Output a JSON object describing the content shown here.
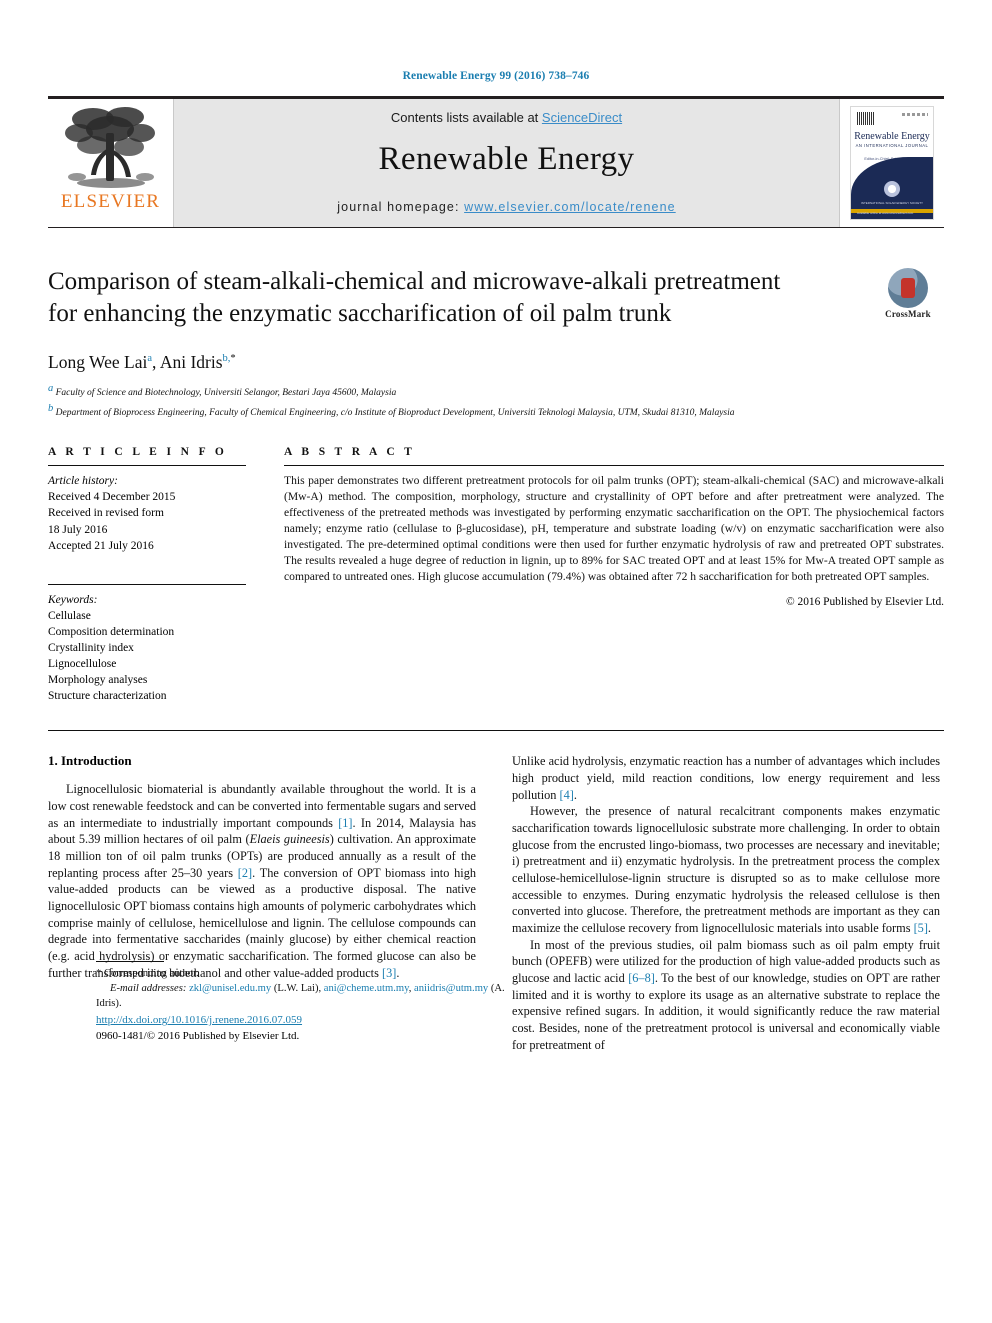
{
  "running_head": "Renewable Energy 99 (2016) 738–746",
  "masthead": {
    "publisher_logo_label": "ELSEVIER",
    "contents_prefix": "Contents lists available at ",
    "contents_link": "ScienceDirect",
    "journal_name": "Renewable Energy",
    "homepage_prefix": "journal homepage: ",
    "homepage_url": "www.elsevier.com/locate/renene",
    "cover": {
      "title": "Renewable Energy",
      "subtitle": "AN INTERNATIONAL JOURNAL",
      "editor": "Editor-in-Chief: Soteris Kalogirou",
      "footer": "Available online at\nwww.sciencedirect.com",
      "seal_text": "INTERNATIONAL SOLAR\nENERGY SOCIETY"
    }
  },
  "article": {
    "title": "Comparison of steam-alkali-chemical and microwave-alkali pretreatment for enhancing the enzymatic saccharification of oil palm trunk",
    "crossmark_label": "CrossMark",
    "authors_plain": "Long Wee Lai ",
    "author_1": "Long Wee Lai",
    "author_1_sup": "a",
    "author_2": "Ani Idris",
    "author_2_sup": "b,",
    "author_2_star": "*",
    "affiliation_a_sup": "a",
    "affiliation_a": "Faculty of Science and Biotechnology, Universiti Selangor, Bestari Jaya 45600, Malaysia",
    "affiliation_b_sup": "b",
    "affiliation_b": "Department of Bioprocess Engineering, Faculty of Chemical Engineering, c/o Institute of Bioproduct Development, Universiti Teknologi Malaysia, UTM, Skudai 81310, Malaysia"
  },
  "article_info": {
    "heading": "A R T I C L E   I N F O",
    "history_label": "Article history:",
    "history": [
      "Received 4 December 2015",
      "Received in revised form",
      "18 July 2016",
      "Accepted 21 July 2016"
    ],
    "keywords_label": "Keywords:",
    "keywords": [
      "Cellulase",
      "Composition determination",
      "Crystallinity index",
      "Lignocellulose",
      "Morphology analyses",
      "Structure characterization"
    ]
  },
  "abstract": {
    "heading": "A B S T R A C T",
    "text": "This paper demonstrates two different pretreatment protocols for oil palm trunks (OPT); steam-alkali-chemical (SAC) and microwave-alkali (Mw-A) method. The composition, morphology, structure and crystallinity of OPT before and after pretreatment were analyzed. The effectiveness of the pretreated methods was investigated by performing enzymatic saccharification on the OPT. The physiochemical factors namely; enzyme ratio (cellulase to β-glucosidase), pH, temperature and substrate loading (w/v) on enzymatic saccharification were also investigated. The pre-determined optimal conditions were then used for further enzymatic hydrolysis of raw and pretreated OPT substrates. The results revealed a huge degree of reduction in lignin, up to 89% for SAC treated OPT and at least 15% for Mw-A treated OPT sample as compared to untreated ones. High glucose accumulation (79.4%) was obtained after 72 h saccharification for both pretreated OPT samples.",
    "copyright": "© 2016 Published by Elsevier Ltd."
  },
  "body": {
    "section_heading": "1. Introduction",
    "left_paragraphs": [
      {
        "pre": "Lignocellulosic biomaterial is abundantly available throughout the world. It is a low cost renewable feedstock and can be converted into fermentable sugars and served as an intermediate to industrially important compounds ",
        "ref1": "[1]",
        "mid": ". In 2014, Malaysia has about 5.39 million hectares of oil palm (",
        "italic": "Elaeis guineesis",
        "mid2": ") cultivation. An approximate 18 million ton of oil palm trunks (OPTs) are produced annually as a result of the replanting process after 25–30 years ",
        "ref2": "[2]",
        "mid3": ". The conversion of OPT biomass into high value-added products can be viewed as a productive disposal. The native lignocellulosic OPT biomass contains high amounts of polymeric carbohydrates which comprise mainly of cellulose, hemicellulose and lignin. The cellulose compounds can degrade into fermentative saccharides (mainly glucose) by either chemical reaction (e.g. acid hydrolysis) or enzymatic saccharification. The formed glucose can also be further transformed into bioethanol and other value-added products ",
        "ref3": "[3]",
        "post": "."
      }
    ],
    "right_paragraphs": [
      {
        "pre": "Unlike acid hydrolysis, enzymatic reaction has a number of advantages which includes high product yield, mild reaction conditions, low energy requirement and less pollution ",
        "ref1": "[4]",
        "post": "."
      },
      {
        "pre": "However, the presence of natural recalcitrant components makes enzymatic saccharification towards lignocellulosic substrate more challenging. In order to obtain glucose from the encrusted lingo-biomass, two processes are necessary and inevitable; i) pretreatment and ii) enzymatic hydrolysis. In the pretreatment process the complex cellulose-hemicellulose-lignin structure is disrupted so as to make cellulose more accessible to enzymes. During enzymatic hydrolysis the released cellulose is then converted into glucose. Therefore, the pretreatment methods are important as they can maximize the cellulose recovery from lignocellulosic materials into usable forms ",
        "ref1": "[5]",
        "post": "."
      },
      {
        "pre": "In most of the previous studies, oil palm biomass such as oil palm empty fruit bunch (OPEFB) were utilized for the production of high value-added products such as glucose and lactic acid ",
        "ref1": "[6–8]",
        "post": ". To the best of our knowledge, studies on OPT are rather limited and it is worthy to explore its usage as an alternative substrate to replace the expensive refined sugars. In addition, it would significantly reduce the raw material cost. Besides, none of the pretreatment protocol is universal and economically viable for pretreatment of"
      }
    ]
  },
  "footnote": {
    "star": "*",
    "corresponding": " Corresponding author.",
    "email_label": "E-mail addresses:",
    "email_1": "zkl@unisel.edu.my",
    "email_1_name": " (L.W. Lai), ",
    "email_2": "ani@cheme.utm.my",
    "email_2_sep": ", ",
    "email_3": "aniidris@utm.my",
    "email_3_name": " (A. Idris)."
  },
  "doi_block": {
    "doi": "http://dx.doi.org/10.1016/j.renene.2016.07.059",
    "issn_line": "0960-1481/© 2016 Published by Elsevier Ltd."
  },
  "colors": {
    "link": "#1b7eb0",
    "accent_orange": "#e87722",
    "masthead_bg": "#e6e6e6"
  }
}
